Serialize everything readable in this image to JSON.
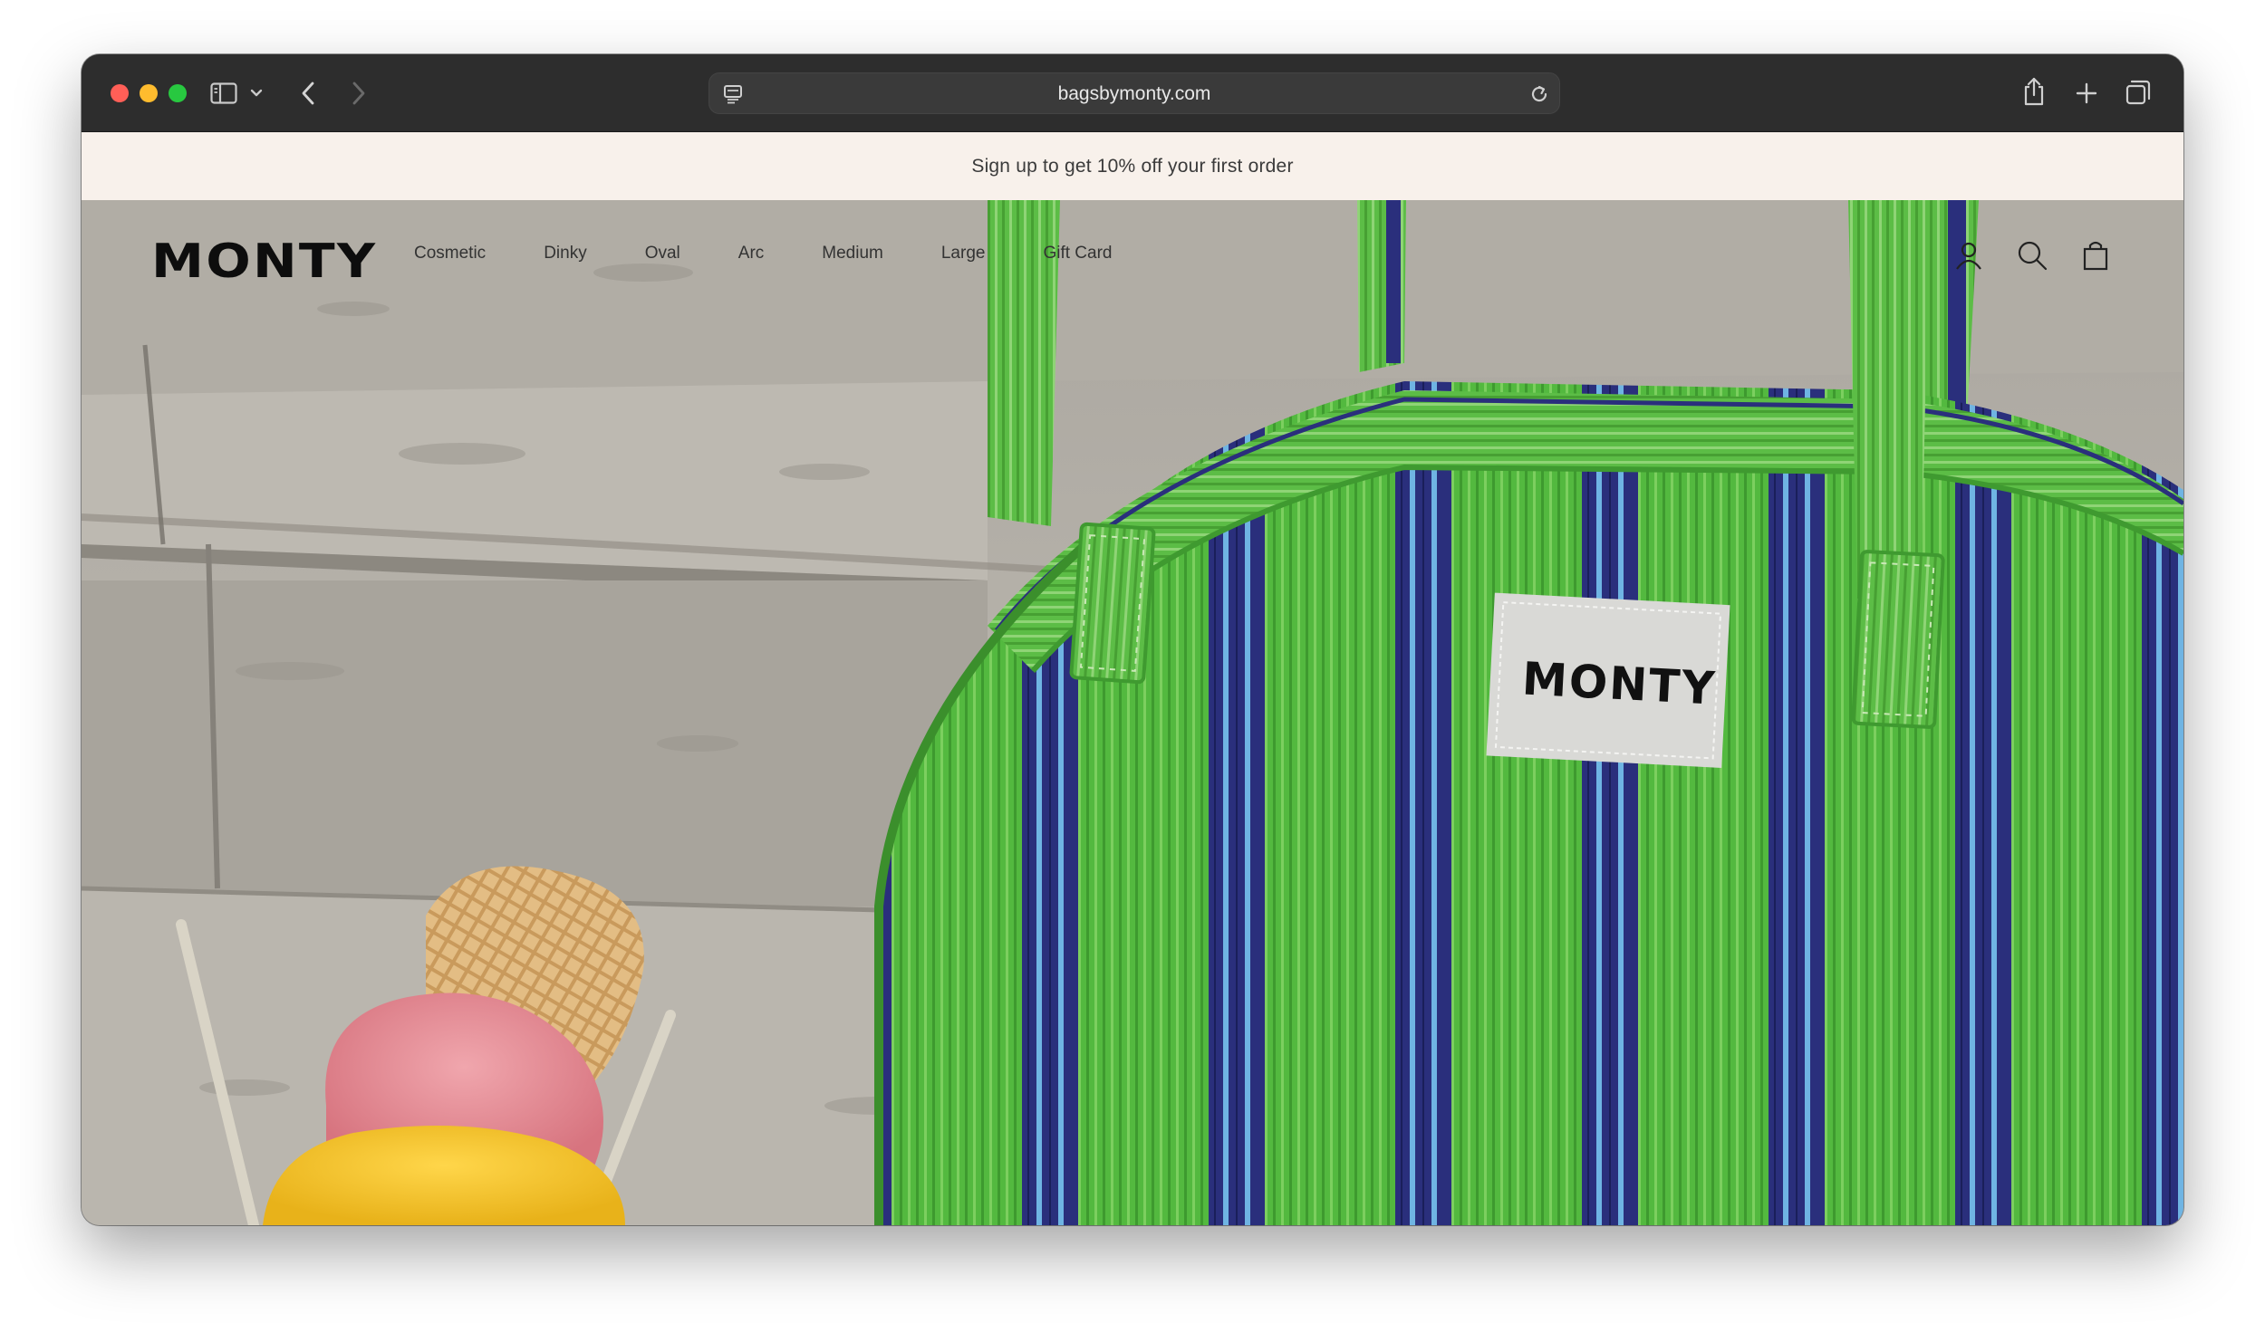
{
  "browser": {
    "url": "bagsbymonty.com",
    "icons": {
      "sidebar": "sidebar-icon",
      "back": "chevron-left-icon",
      "forward": "chevron-right-icon",
      "reader": "reader-icon",
      "reload": "reload-icon",
      "share": "share-icon",
      "new_tab": "plus-icon",
      "tabs": "tab-overview-icon"
    }
  },
  "announcement": {
    "text": "Sign up to get 10% off your first order"
  },
  "header": {
    "logo": "MONTY",
    "nav": [
      "Cosmetic",
      "Dinky",
      "Oval",
      "Arc",
      "Medium",
      "Large",
      "Gift Card"
    ],
    "icons": [
      "account-icon",
      "search-icon",
      "cart-icon"
    ]
  },
  "hero": {
    "bag_label": "MONTY"
  },
  "colors": {
    "announcement_bg": "#f8f1eb",
    "bag_green": "#4fb83a",
    "stripe_navy": "#26307a",
    "stripe_blue": "#5aa6d8"
  }
}
